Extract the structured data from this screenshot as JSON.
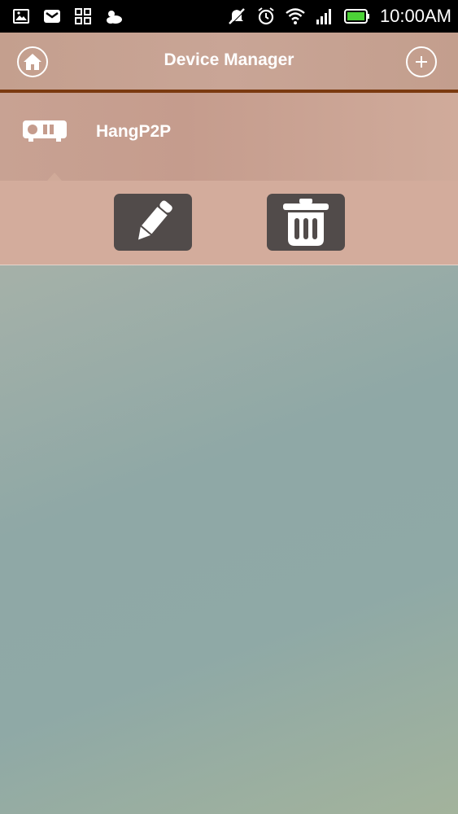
{
  "status_bar": {
    "time": "10:00AM",
    "left_icons": [
      "gallery-icon",
      "mail-icon",
      "apps-icon",
      "weather-icon"
    ],
    "right_icons": [
      "mute-icon",
      "alarm-icon",
      "wifi-icon",
      "signal-icon",
      "battery-icon"
    ]
  },
  "header": {
    "title": "Device Manager",
    "home_icon": "home-icon",
    "add_icon": "plus-icon",
    "accent_color": "#7b3a10"
  },
  "devices": [
    {
      "name": "HangP2P",
      "icon": "camera-device-icon"
    }
  ],
  "actions": {
    "edit_icon": "pencil-icon",
    "delete_icon": "trash-icon"
  }
}
